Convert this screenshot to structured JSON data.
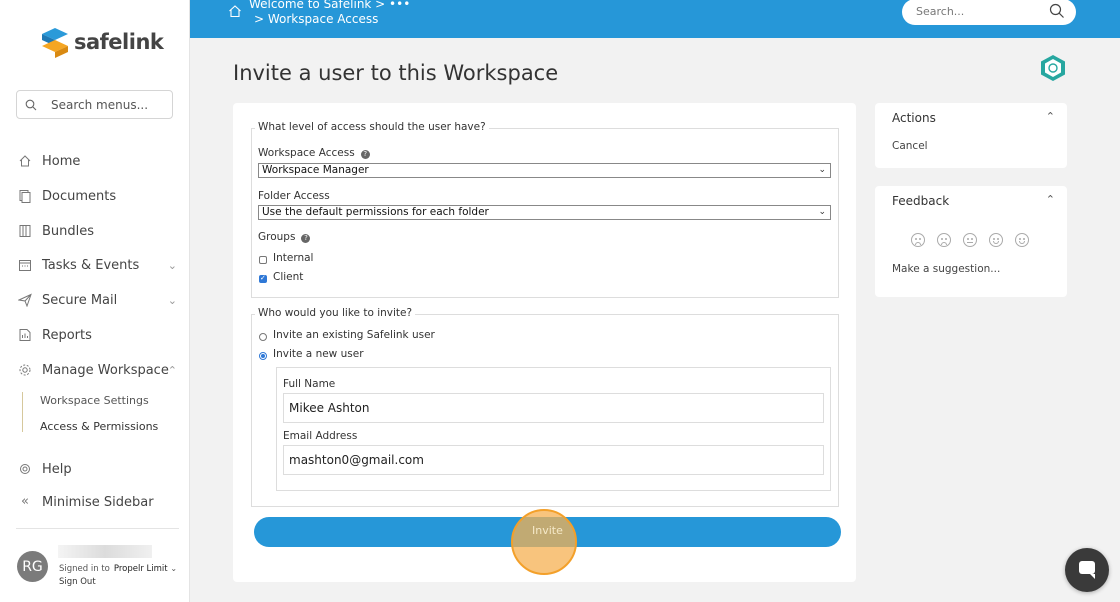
{
  "sidebar": {
    "brand": "safelink",
    "search_placeholder": "Search menus...",
    "items": [
      {
        "label": "Home",
        "icon": "home-icon"
      },
      {
        "label": "Documents",
        "icon": "documents-icon"
      },
      {
        "label": "Bundles",
        "icon": "bundles-icon"
      },
      {
        "label": "Tasks & Events",
        "icon": "calendar-icon"
      },
      {
        "label": "Secure Mail",
        "icon": "send-icon"
      },
      {
        "label": "Reports",
        "icon": "reports-icon"
      },
      {
        "label": "Manage Workspace",
        "icon": "gear-icon"
      },
      {
        "label": "Help",
        "icon": "help-icon"
      },
      {
        "label": "Minimise Sidebar",
        "icon": "collapse-icon"
      }
    ],
    "sub_items": [
      "Workspace Settings",
      "Access & Permissions"
    ],
    "user": {
      "initials": "RG",
      "signed_in_label": "Signed in to",
      "org": "Propelr Limit",
      "sign_out": "Sign Out"
    }
  },
  "header": {
    "breadcrumb_1": "Welcome to Safelink  >  •••",
    "breadcrumb_2": ">  Workspace Access",
    "search_placeholder": "Search...",
    "accent": "#2697d8"
  },
  "main": {
    "title": "Invite a user to this Workspace",
    "access_section": {
      "legend": "What level of access should the user have?",
      "workspace_access_label": "Workspace Access",
      "workspace_access_value": "Workspace Manager",
      "folder_access_label": "Folder Access",
      "folder_access_value": "Use the default permissions for each folder",
      "groups_label": "Groups",
      "groups": [
        {
          "label": "Internal",
          "checked": false
        },
        {
          "label": "Client",
          "checked": true
        }
      ]
    },
    "invite_section": {
      "legend": "Who would you like to invite?",
      "options": [
        {
          "label": "Invite an existing Safelink user",
          "selected": false
        },
        {
          "label": "Invite a new user",
          "selected": true
        }
      ],
      "full_name_label": "Full Name",
      "full_name_value": "Mikee Ashton",
      "email_label": "Email Address",
      "email_value": "mashton0@gmail.com"
    },
    "invite_button": "Invite"
  },
  "actions_panel": {
    "title": "Actions",
    "cancel": "Cancel"
  },
  "feedback_panel": {
    "title": "Feedback",
    "suggestion": "Make a suggestion..."
  }
}
